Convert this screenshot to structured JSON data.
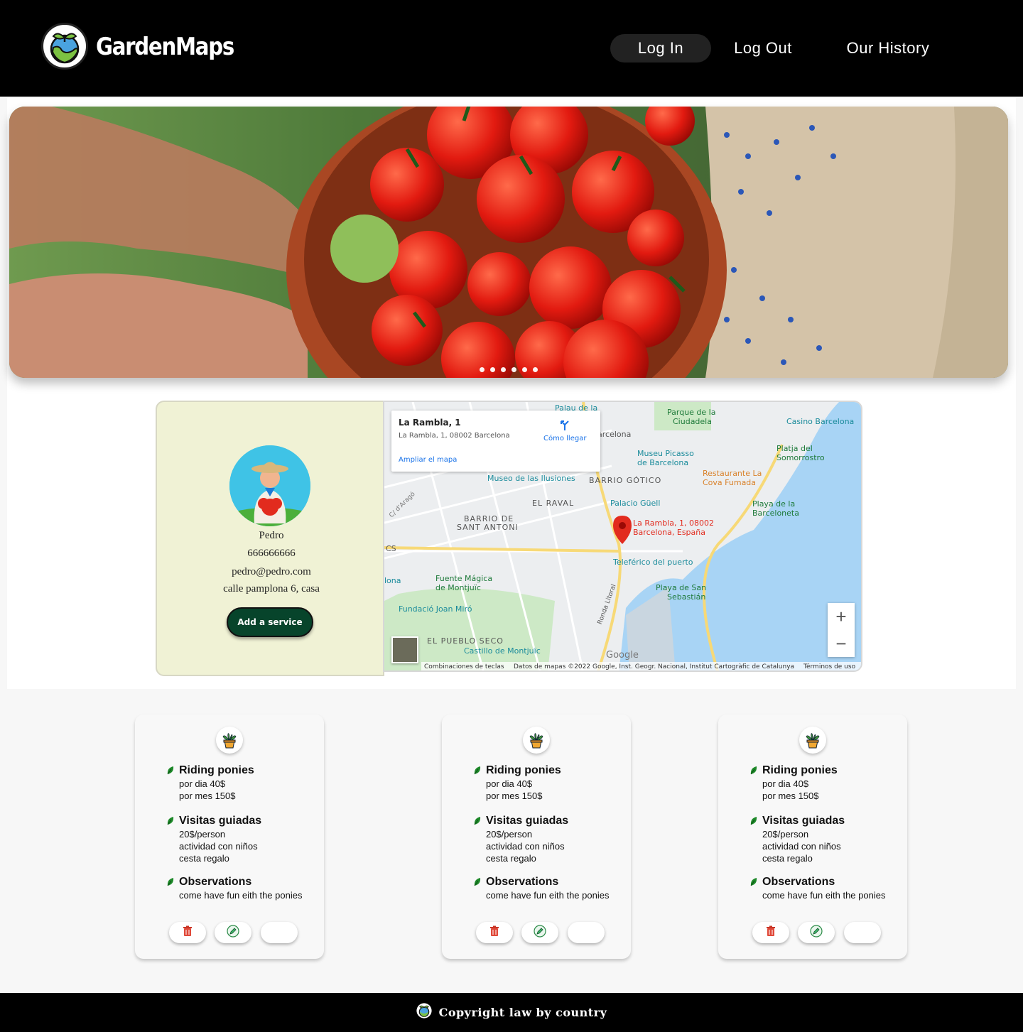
{
  "app": {
    "brand": "GardenMaps"
  },
  "nav": {
    "login": "Log In",
    "logout": "Log Out",
    "history": "Our History"
  },
  "hero": {
    "slide_count": 6
  },
  "profile": {
    "name": "Pedro",
    "phone": "666666666",
    "email": "pedro@pedro.com",
    "address": "calle pamplona 6, casa",
    "add_service": "Add a service"
  },
  "map": {
    "place_title": "La Rambla, 1",
    "place_address": "La Rambla, 1, 08002 Barcelona",
    "directions": "Cómo llegar",
    "enlarge": "Ampliar el mapa",
    "marker_label_1": "La Rambla, 1, 08002",
    "marker_label_2": "Barcelona, España",
    "footer_keys": "Combinaciones de teclas",
    "footer_data": "Datos de mapas ©2022 Google, Inst. Geogr. Nacional, Institut Cartogràfic de Catalunya",
    "footer_terms": "Términos de uso",
    "google": "Google",
    "labels": [
      "Palau de la",
      "Parque de la",
      "Ciudadela",
      "Casino Barcelona",
      "arcelona",
      "Museu Picasso",
      "de Barcelona",
      "Platja del",
      "Somorrostro",
      "Museo de las Ilusiones",
      "BARRIO GÓTICO",
      "Restaurante La",
      "Cova Fumada",
      "EL RAVAL",
      "Palacio Güell",
      "Playa de la",
      "Barceloneta",
      "BARRIO DE",
      "SANT ANTONI",
      "Teleférico del puerto",
      "Fuente Mágica",
      "de Montjuïc",
      "Playa de San",
      "Sebastián",
      "Fundació Joan Miró",
      "EL PUEBLO SECO",
      "Castillo de Montjuïc",
      "lona",
      "CS",
      "Ronda Litoral",
      "C/ d'Aragó"
    ]
  },
  "cards": [
    {
      "sections": [
        {
          "title": "Riding ponies",
          "lines": [
            "por dia 40$",
            "por mes 150$"
          ]
        },
        {
          "title": "Visitas guiadas",
          "lines": [
            "20$/person",
            "actividad con niños",
            "cesta regalo"
          ]
        },
        {
          "title": "Observations",
          "lines": [
            "come have fun eith the ponies"
          ]
        }
      ]
    },
    {
      "sections": [
        {
          "title": "Riding ponies",
          "lines": [
            "por dia 40$",
            "por mes 150$"
          ]
        },
        {
          "title": "Visitas guiadas",
          "lines": [
            "20$/person",
            "actividad con niños",
            "cesta regalo"
          ]
        },
        {
          "title": "Observations",
          "lines": [
            "come have fun eith the ponies"
          ]
        }
      ]
    },
    {
      "sections": [
        {
          "title": "Riding ponies",
          "lines": [
            "por dia 40$",
            "por mes 150$"
          ]
        },
        {
          "title": "Visitas guiadas",
          "lines": [
            "20$/person",
            "actividad con niños",
            "cesta regalo"
          ]
        },
        {
          "title": "Observations",
          "lines": [
            "come have fun eith the ponies"
          ]
        }
      ]
    }
  ],
  "footer": {
    "text": "Copyright law by country"
  },
  "colors": {
    "header_bg": "#000000",
    "accent_green": "#07442b",
    "leaf_green": "#1e8a2a",
    "profile_bg": "#f0f2d5",
    "delete_red": "#e04a3a"
  },
  "icons": {
    "logo": "globe-sprout-icon",
    "card": "potted-plant-icon",
    "delete": "trash-icon",
    "edit": "pencil-icon",
    "bullet": "leaf-icon"
  }
}
